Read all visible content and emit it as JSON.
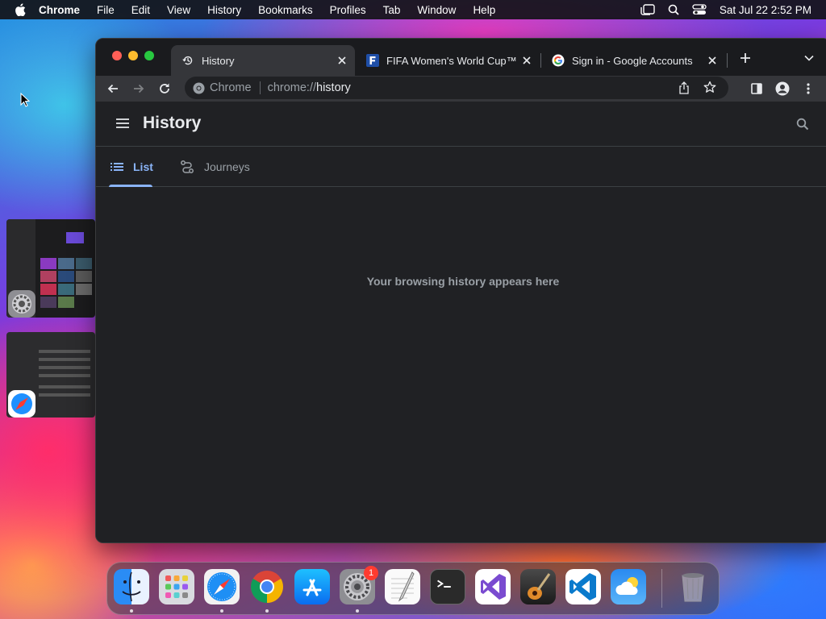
{
  "menubar": {
    "app_name": "Chrome",
    "items": [
      "File",
      "Edit",
      "View",
      "History",
      "Bookmarks",
      "Profiles",
      "Tab",
      "Window",
      "Help"
    ],
    "clock": "Sat Jul 22  2:52 PM"
  },
  "tabs": [
    {
      "title": "History",
      "icon": "history-icon",
      "active": true
    },
    {
      "title": "FIFA Women's World Cup™",
      "icon": "fifa-icon",
      "active": false
    },
    {
      "title": "Sign in - Google Accounts",
      "icon": "google-icon",
      "active": false
    }
  ],
  "omnibox": {
    "chip_label": "Chrome",
    "url_scheme": "chrome://",
    "url_path": "history"
  },
  "page": {
    "title": "History",
    "tabs": [
      {
        "label": "List",
        "selected": true
      },
      {
        "label": "Journeys",
        "selected": false
      }
    ],
    "empty_message": "Your browsing history appears here"
  },
  "dock": {
    "apps": [
      "Finder",
      "Launchpad",
      "Safari",
      "Chrome",
      "App Store",
      "System Settings",
      "TextEdit",
      "Terminal",
      "Visual Studio",
      "GarageBand",
      "Visual Studio Code",
      "Weather",
      "Trash"
    ],
    "system_settings_badge": "1"
  },
  "colors": {
    "accent": "#8ab4f8",
    "page_bg": "#202124",
    "toolbar_bg": "#35363a"
  }
}
